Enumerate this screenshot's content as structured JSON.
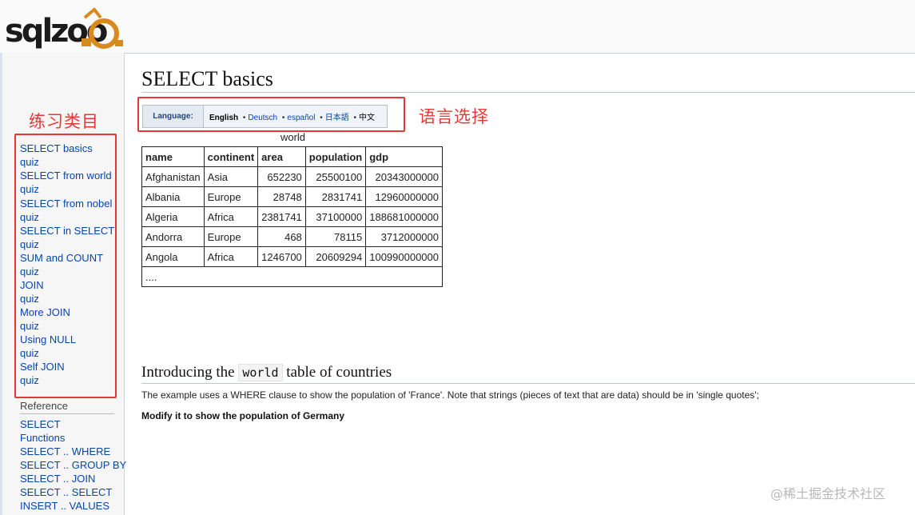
{
  "logo": {
    "text": "sqlzoo"
  },
  "annotations": {
    "sidebar_caption": "练习类目",
    "language_caption": "语言选择"
  },
  "sidebar": {
    "tutorials": [
      {
        "label": "SELECT basics"
      },
      {
        "label": "quiz"
      },
      {
        "label": "SELECT from world"
      },
      {
        "label": "quiz"
      },
      {
        "label": "SELECT from nobel"
      },
      {
        "label": "quiz"
      },
      {
        "label": "SELECT in SELECT"
      },
      {
        "label": "quiz"
      },
      {
        "label": "SUM and COUNT"
      },
      {
        "label": "quiz"
      },
      {
        "label": "JOIN"
      },
      {
        "label": "quiz"
      },
      {
        "label": "More JOIN"
      },
      {
        "label": "quiz"
      },
      {
        "label": "Using NULL"
      },
      {
        "label": "quiz"
      },
      {
        "label": "Self JOIN"
      },
      {
        "label": "quiz"
      }
    ],
    "reference_title": "Reference",
    "reference": [
      {
        "label": "SELECT"
      },
      {
        "label": "Functions"
      },
      {
        "label": "SELECT .. WHERE"
      },
      {
        "label": "SELECT .. GROUP BY"
      },
      {
        "label": "SELECT .. JOIN"
      },
      {
        "label": "SELECT .. SELECT"
      },
      {
        "label": "INSERT .. VALUES"
      }
    ]
  },
  "main": {
    "title": "SELECT basics",
    "language": {
      "label": "Language:",
      "current": "English",
      "options": [
        "Deutsch",
        "español",
        "日本語",
        "中文"
      ]
    },
    "table": {
      "caption": "world",
      "columns": [
        "name",
        "continent",
        "area",
        "population",
        "gdp"
      ],
      "rows": [
        [
          "Afghanistan",
          "Asia",
          "652230",
          "25500100",
          "20343000000"
        ],
        [
          "Albania",
          "Europe",
          "28748",
          "2831741",
          "12960000000"
        ],
        [
          "Algeria",
          "Africa",
          "2381741",
          "37100000",
          "188681000000"
        ],
        [
          "Andorra",
          "Europe",
          "468",
          "78115",
          "3712000000"
        ],
        [
          "Angola",
          "Africa",
          "1246700",
          "20609294",
          "100990000000"
        ]
      ],
      "more": "...."
    },
    "section": {
      "heading_pre": "Introducing the ",
      "heading_code": "world",
      "heading_post": " table of countries",
      "paragraph": "The example uses a WHERE clause to show the population of 'France'. Note that strings (pieces of text that are data) should be in 'single quotes';",
      "task": "Modify it to show the population of Germany"
    }
  },
  "watermark": "@稀土掘金技术社区"
}
